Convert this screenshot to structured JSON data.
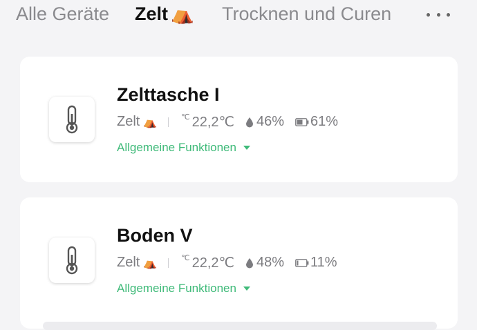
{
  "tabs": [
    {
      "label": "Alle Geräte",
      "active": false
    },
    {
      "label": "Zelt",
      "emoji": "⛺",
      "active": true
    },
    {
      "label": "Trocknen und Curen",
      "active": false
    }
  ],
  "more_icon": "more-horizontal-icon",
  "accent_color": "#3fba79",
  "devices": [
    {
      "name": "Zelttasche I",
      "room": "Zelt",
      "room_emoji": "⛺",
      "temp_unit": "℃",
      "temperature": "22,2℃",
      "humidity": "46%",
      "battery": "61%",
      "functions_label": "Allgemeine Funktionen",
      "icon": "thermometer-icon"
    },
    {
      "name": "Boden V",
      "room": "Zelt",
      "room_emoji": "⛺",
      "temp_unit": "℃",
      "temperature": "22,2℃",
      "humidity": "48%",
      "battery": "11%",
      "functions_label": "Allgemeine Funktionen",
      "icon": "thermometer-icon"
    }
  ]
}
